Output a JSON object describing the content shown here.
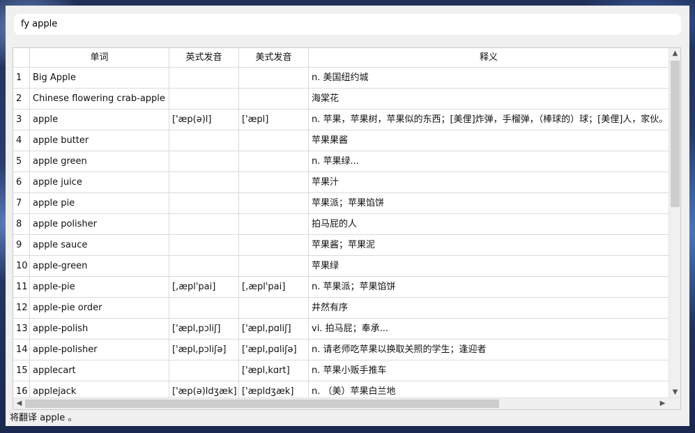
{
  "search": {
    "value": "fy apple"
  },
  "table": {
    "columns": [
      "",
      "单词",
      "英式发音",
      "美式发音",
      "释义"
    ],
    "rows": [
      [
        "1",
        "Big Apple",
        "",
        "",
        "n. 美国纽约城"
      ],
      [
        "2",
        "Chinese flowering crab-apple",
        "",
        "",
        "海棠花"
      ],
      [
        "3",
        "apple",
        "['æp(ə)l]",
        "['æpl]",
        "n. 苹果，苹果树，苹果似的东西；[美俚]炸弹，手榴弹，（棒球的）球；[美俚]人，家伙。"
      ],
      [
        "4",
        "apple butter",
        "",
        "",
        "苹果果酱"
      ],
      [
        "5",
        "apple green",
        "",
        "",
        "n. 苹果绿..."
      ],
      [
        "6",
        "apple juice",
        "",
        "",
        "苹果汁"
      ],
      [
        "7",
        "apple pie",
        "",
        "",
        "苹果派；苹果馅饼"
      ],
      [
        "8",
        "apple polisher",
        "",
        "",
        "拍马屁的人"
      ],
      [
        "9",
        "apple sauce",
        "",
        "",
        "苹果酱；苹果泥"
      ],
      [
        "10",
        "apple-green",
        "",
        "",
        "苹果绿"
      ],
      [
        "11",
        "apple-pie",
        "[,æpl'pai]",
        "[,æpl'pai]",
        "n. 苹果派；苹果馅饼"
      ],
      [
        "12",
        "apple-pie order",
        "",
        "",
        "井然有序"
      ],
      [
        "13",
        "apple-polish",
        "['æpl,pɔliʃ]",
        "['æpl,pɑliʃ]",
        "vi. 拍马屁；奉承..."
      ],
      [
        "14",
        "apple-polisher",
        "['æpl,pɔliʃə]",
        "['æpl,pɑliʃə]",
        "n. 请老师吃苹果以换取关照的学生；逢迎者"
      ],
      [
        "15",
        "applecart",
        "",
        "['æpl,kɑrt]",
        "n. 苹果小贩手推车"
      ],
      [
        "16",
        "applejack",
        "['æp(ə)ldʒæk]",
        "['æpldʒæk]",
        "n. （美）苹果白兰地"
      ]
    ]
  },
  "scroll": {
    "up": "▲",
    "down": "▼",
    "left": "◀",
    "right": "▶"
  },
  "status": {
    "text": "将翻译 apple 。"
  }
}
